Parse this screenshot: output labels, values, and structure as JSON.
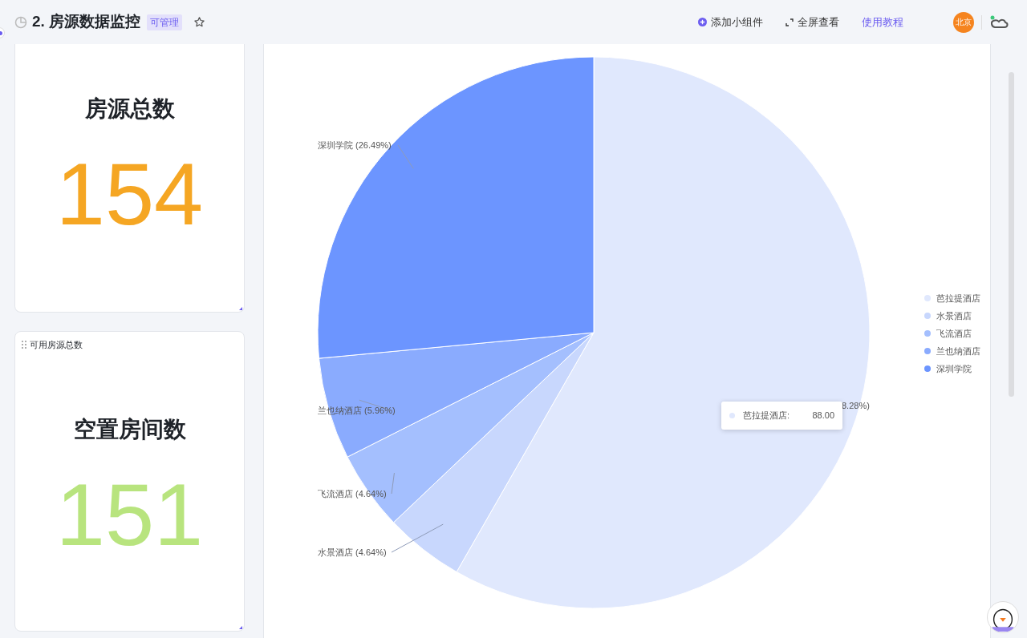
{
  "header": {
    "title": "2. 房源数据监控",
    "badge": "可管理",
    "actions": [
      {
        "kind": "add",
        "label": "添加小组件"
      },
      {
        "kind": "fullscreen",
        "label": "全屏查看"
      },
      {
        "kind": "link",
        "label": "使用教程"
      }
    ],
    "avatar": "北京"
  },
  "widgets": [
    {
      "title": "房源总数",
      "value": "154",
      "color": "#f5a623"
    },
    {
      "header": "可用房源总数",
      "title": "空置房间数",
      "value": "151",
      "color": "#b8e47e"
    }
  ],
  "chart": {
    "chart_data": {
      "type": "pie",
      "categories": [
        "芭拉提酒店",
        "水景酒店",
        "飞流酒店",
        "兰也纳酒店",
        "深圳学院"
      ],
      "values": [
        58.28,
        4.64,
        4.64,
        5.96,
        26.49
      ],
      "colors": [
        "#e0e8fd",
        "#c8d7fd",
        "#a4bffe",
        "#8aabfe",
        "#6c95ff"
      ],
      "value_labels": [
        null,
        "水景酒店 (4.64%)",
        "飞流酒店 (4.64%)",
        "兰也纳酒店 (5.96%)",
        "深圳学院 (26.49%)"
      ],
      "legend": true
    },
    "covered_label": "8.28%)",
    "tooltip": {
      "label": "芭拉提酒店:",
      "value": "88.00",
      "color": "#e0e8fd"
    }
  }
}
